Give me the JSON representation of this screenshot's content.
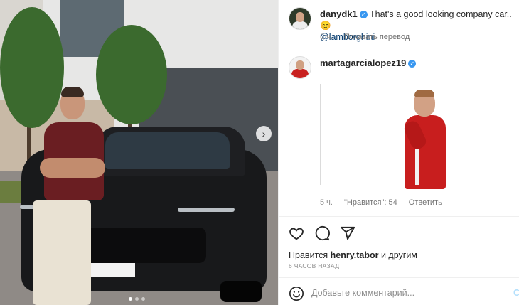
{
  "post": {
    "carousel": {
      "next_icon": "chevron-right-icon",
      "slides": 3,
      "active_slide": 1
    }
  },
  "comments": [
    {
      "username": "danydk1",
      "verified": true,
      "text": "That's a good looking company car.. ☺️",
      "mention": "@lamborghini",
      "age": "6 ч.",
      "action": "Показать перевод"
    },
    {
      "username": "martagarcialopez19",
      "verified": true,
      "gif": "gif-reaction",
      "age": "5 ч.",
      "likes": "\"Нравится\": 54",
      "reply": "Ответить"
    }
  ],
  "actions": {
    "like_icon": "heart-icon",
    "comment_icon": "comment-icon",
    "share_icon": "share-icon"
  },
  "likes": {
    "prefix": "Нравится ",
    "user": "henry.tabor",
    "suffix": " и другим"
  },
  "time_ago": "6 ЧАСОВ НАЗАД",
  "comment_box": {
    "placeholder": "Добавьте комментарий...",
    "post_label": "С",
    "emoji_icon": "smiley-icon"
  },
  "colors": {
    "verified": "#3897f0",
    "mention": "#00376b",
    "muted": "#8e8e8e"
  }
}
